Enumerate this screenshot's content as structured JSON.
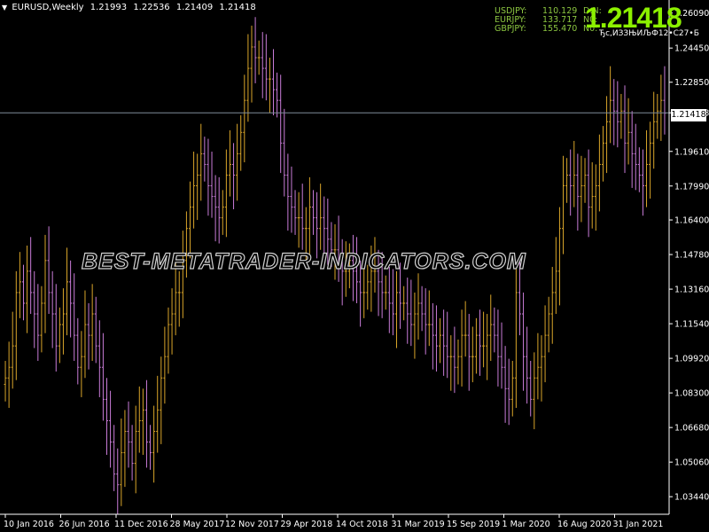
{
  "window": {
    "symbol_timeframe": "EURUSD,Weekly",
    "ohlc": [
      "1.21993",
      "1.22536",
      "1.21409",
      "1.21418"
    ]
  },
  "ticker_panel": [
    {
      "symbol": "USDJPY:",
      "value": "110.129",
      "flag": "D:N:"
    },
    {
      "symbol": "EURJPY:",
      "value": "133.717",
      "flag": "N0:"
    },
    {
      "symbol": "GBPJPY:",
      "value": "155.470",
      "flag": "N0:"
    }
  ],
  "big_price": "1.21418",
  "small_note": "Ђс,ИЗЗЊИЉФ12•С27•Б",
  "watermark": "BEST-METATRADER-INDICATORS.COM",
  "current_price_tag": "1.21418",
  "colors": {
    "background": "#000000",
    "bull_bar": "#d9a52a",
    "bear_bar": "#c97cd8",
    "axis": "#ffffff",
    "price_line": "#7f8c99",
    "ticker_text": "#8cc640",
    "big_price": "#8cf000"
  },
  "chart_data": {
    "type": "bar",
    "title": "",
    "xlabel": "",
    "ylabel": "",
    "ylim": [
      1.027,
      1.267
    ],
    "y_ticks": [
      "1.26090",
      "1.24450",
      "1.22850",
      "1.21418",
      "1.19610",
      "1.17990",
      "1.16400",
      "1.14780",
      "1.13160",
      "1.11540",
      "1.09920",
      "1.08300",
      "1.06680",
      "1.05060",
      "1.03440"
    ],
    "x_ticks": [
      "10 Jan 2016",
      "26 Jun 2016",
      "11 Dec 2016",
      "28 May 2017",
      "12 Nov 2017",
      "29 Apr 2018",
      "14 Oct 2018",
      "31 Mar 2019",
      "15 Sep 2019",
      "1 Mar 2020",
      "16 Aug 2020",
      "31 Jan 2021"
    ],
    "current_price": 1.21418,
    "closes": [
      1.09,
      1.095,
      1.105,
      1.13,
      1.135,
      1.125,
      1.14,
      1.13,
      1.12,
      1.11,
      1.125,
      1.145,
      1.13,
      1.12,
      1.105,
      1.115,
      1.12,
      1.135,
      1.125,
      1.11,
      1.095,
      1.1,
      1.115,
      1.11,
      1.12,
      1.105,
      1.095,
      1.08,
      1.07,
      1.06,
      1.045,
      1.04,
      1.055,
      1.065,
      1.06,
      1.05,
      1.065,
      1.07,
      1.075,
      1.06,
      1.055,
      1.065,
      1.075,
      1.09,
      1.1,
      1.115,
      1.12,
      1.13,
      1.13,
      1.145,
      1.16,
      1.17,
      1.18,
      1.185,
      1.195,
      1.19,
      1.18,
      1.175,
      1.17,
      1.165,
      1.17,
      1.185,
      1.19,
      1.185,
      1.195,
      1.205,
      1.22,
      1.235,
      1.245,
      1.24,
      1.24,
      1.235,
      1.23,
      1.23,
      1.225,
      1.22,
      1.2,
      1.185,
      1.175,
      1.17,
      1.165,
      1.165,
      1.16,
      1.16,
      1.17,
      1.165,
      1.16,
      1.165,
      1.16,
      1.155,
      1.15,
      1.15,
      1.145,
      1.14,
      1.14,
      1.145,
      1.14,
      1.135,
      1.13,
      1.13,
      1.135,
      1.14,
      1.14,
      1.135,
      1.13,
      1.13,
      1.125,
      1.12,
      1.13,
      1.125,
      1.125,
      1.12,
      1.115,
      1.12,
      1.125,
      1.12,
      1.115,
      1.115,
      1.11,
      1.105,
      1.11,
      1.105,
      1.1,
      1.1,
      1.095,
      1.1,
      1.11,
      1.11,
      1.1,
      1.1,
      1.11,
      1.105,
      1.105,
      1.11,
      1.115,
      1.11,
      1.1,
      1.095,
      1.085,
      1.08,
      1.09,
      1.13,
      1.12,
      1.1,
      1.09,
      1.08,
      1.09,
      1.095,
      1.1,
      1.11,
      1.12,
      1.13,
      1.14,
      1.16,
      1.18,
      1.185,
      1.18,
      1.185,
      1.175,
      1.18,
      1.185,
      1.17,
      1.175,
      1.18,
      1.19,
      1.2,
      1.21,
      1.22,
      1.215,
      1.21,
      1.215,
      1.2,
      1.205,
      1.195,
      1.19,
      1.185,
      1.18,
      1.19,
      1.2,
      1.21,
      1.215,
      1.22,
      1.214
    ]
  }
}
